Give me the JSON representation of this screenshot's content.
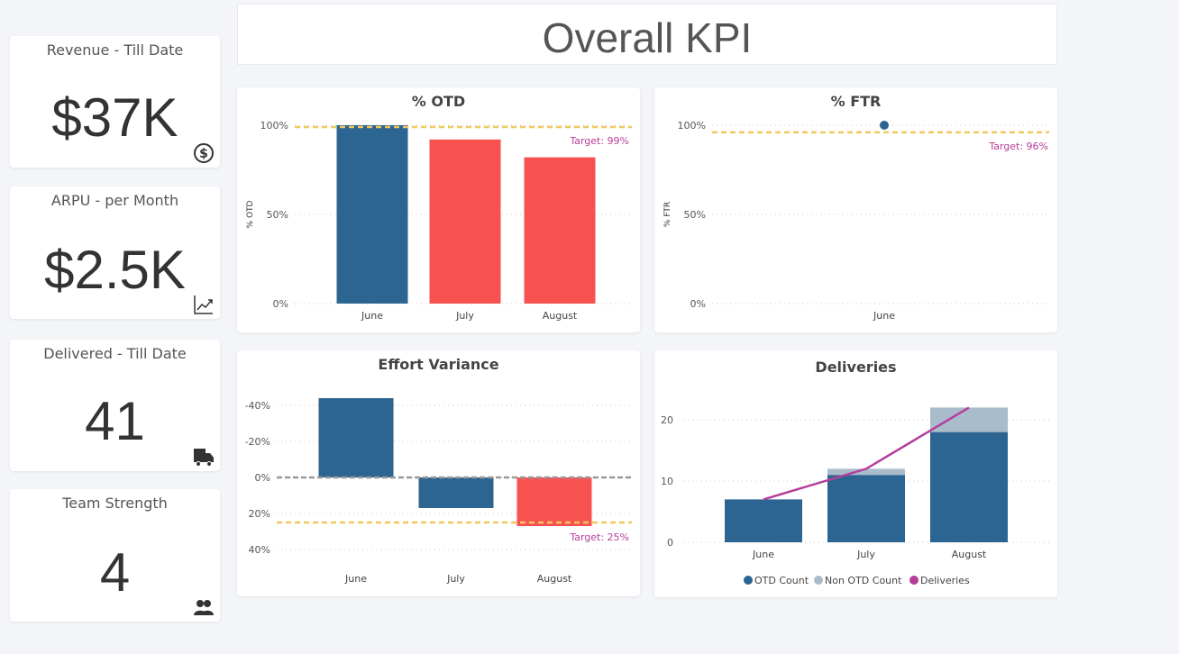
{
  "header": {
    "title": "Overall KPI"
  },
  "kpis": [
    {
      "title": "Revenue - Till Date",
      "value": "$37K",
      "icon": "dollar-icon"
    },
    {
      "title": "ARPU - per Month",
      "value": "$2.5K",
      "icon": "trend-chart-icon"
    },
    {
      "title": "Delivered - Till Date",
      "value": "41",
      "icon": "delivery-truck-icon"
    },
    {
      "title": "Team Strength",
      "value": "4",
      "icon": "team-icon"
    }
  ],
  "colors": {
    "navy": "#2c6591",
    "red": "#f75150",
    "gold": "#f2c761",
    "magenta": "#b73d9a",
    "light": "#a8bccb",
    "grid": "#c8c8c8"
  },
  "chart_data": [
    {
      "type": "bar",
      "title": "% OTD",
      "ylabel": "% OTD",
      "categories": [
        "June",
        "July",
        "August"
      ],
      "values": [
        100,
        92,
        82
      ],
      "bar_colors": [
        "#2c6591",
        "#f75150",
        "#f75150"
      ],
      "ylim": [
        0,
        100
      ],
      "yticks": [
        "0%",
        "50%",
        "100%"
      ],
      "target": {
        "value": 99,
        "label": "Target: 99%"
      },
      "grid": true
    },
    {
      "type": "scatter",
      "title": "% FTR",
      "ylabel": "% FTR",
      "categories": [
        "June"
      ],
      "values": [
        100
      ],
      "ylim": [
        0,
        100
      ],
      "yticks": [
        "0%",
        "50%",
        "100%"
      ],
      "target": {
        "value": 96,
        "label": "Target: 96%"
      },
      "grid": true
    },
    {
      "type": "bar",
      "title": "Effort Variance",
      "categories": [
        "June",
        "July",
        "August"
      ],
      "values": [
        -44,
        17,
        27
      ],
      "bar_colors": [
        "#2c6591",
        "#2c6591",
        "#f75150"
      ],
      "ylim": [
        -50,
        45
      ],
      "yticks": [
        "-40%",
        "-20%",
        "0%",
        "20%",
        "40%"
      ],
      "ytick_values": [
        -40,
        -20,
        0,
        20,
        40
      ],
      "target": {
        "value": 25,
        "label": "Target: 25%"
      },
      "grid": true
    },
    {
      "type": "bar",
      "title": "Deliveries",
      "categories": [
        "June",
        "July",
        "August"
      ],
      "series": [
        {
          "name": "OTD Count",
          "values": [
            7,
            11,
            18
          ]
        },
        {
          "name": "Non OTD Count",
          "values": [
            0,
            1,
            4
          ]
        },
        {
          "name": "Deliveries",
          "values": [
            7,
            12,
            22
          ]
        }
      ],
      "ylim": [
        0,
        24
      ],
      "yticks": [
        "0",
        "10",
        "20"
      ],
      "ytick_values": [
        0,
        10,
        20
      ],
      "legend": "bottom-center",
      "grid": true
    }
  ]
}
